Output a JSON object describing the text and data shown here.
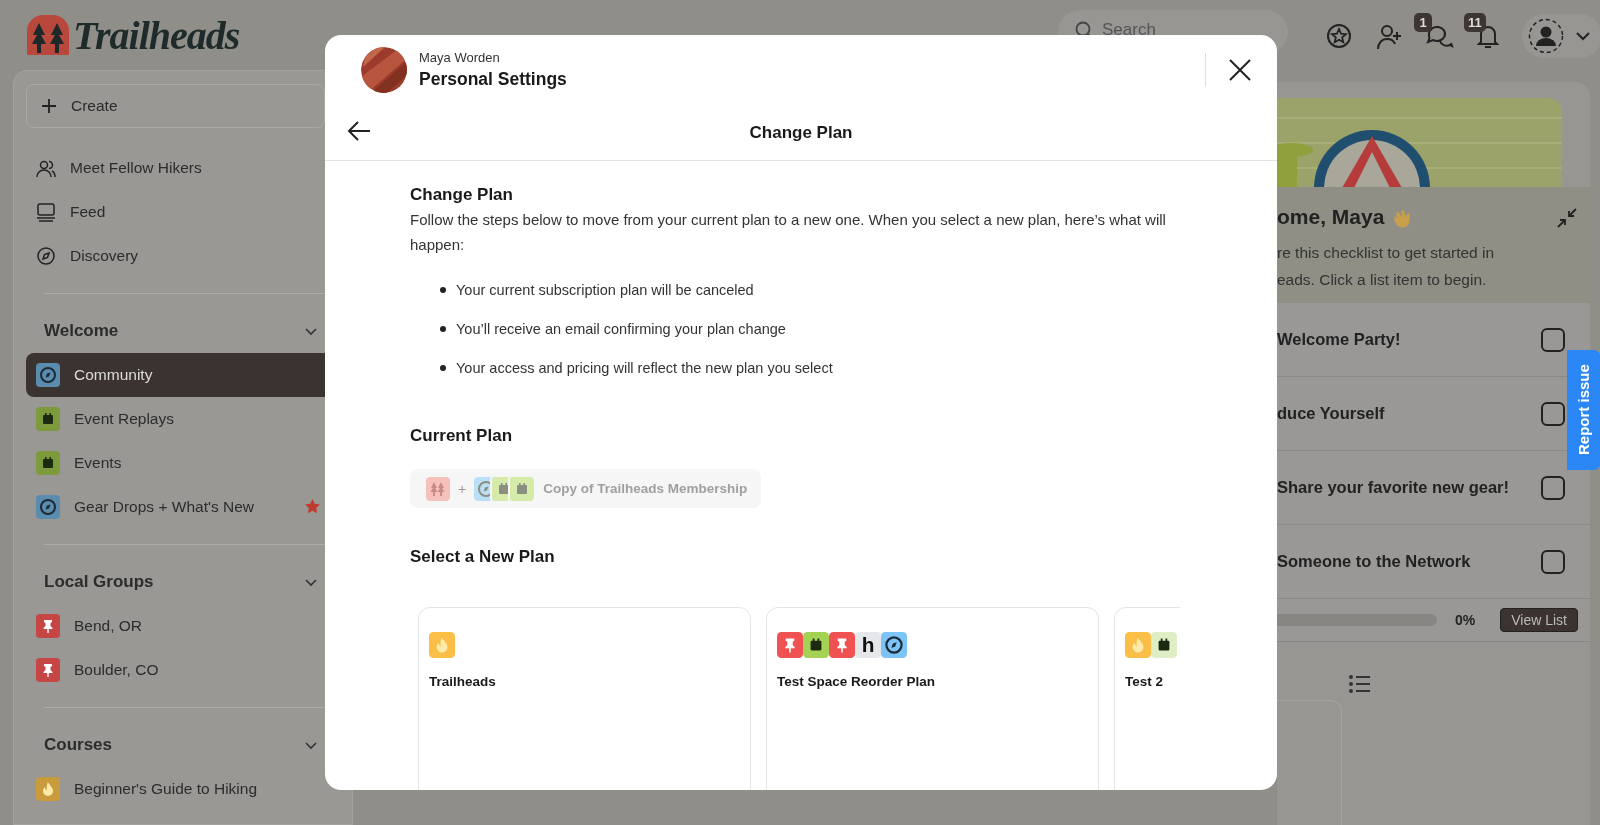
{
  "header": {
    "logo": "Trailheads",
    "search": {
      "placeholder": "Search"
    },
    "badges": [
      {
        "kind": "chat",
        "count": "1"
      },
      {
        "kind": "bell",
        "count": "11"
      }
    ]
  },
  "sidebar": {
    "create": "Create",
    "nav": [
      {
        "kind": "people",
        "label": "Meet Fellow Hikers"
      },
      {
        "kind": "feed",
        "label": "Feed"
      },
      {
        "kind": "compass",
        "label": "Discovery"
      }
    ],
    "sections": [
      {
        "title": "Welcome",
        "expanded": true,
        "items": [
          {
            "label": "Community",
            "kind": "compass",
            "color": "#5a8cb0",
            "selected": true,
            "starred": false
          },
          {
            "label": "Event Replays",
            "kind": "calendar",
            "color": "#7d9a3c",
            "selected": false,
            "starred": false
          },
          {
            "label": "Events",
            "kind": "calendar",
            "color": "#7d9a3c",
            "selected": false,
            "starred": false
          },
          {
            "label": "Gear Drops + What's New",
            "kind": "compass",
            "color": "#5a8cb0",
            "selected": false,
            "starred": true
          }
        ]
      },
      {
        "title": "Local Groups",
        "expanded": true,
        "items": [
          {
            "label": "Bend, OR",
            "kind": "pin",
            "color": "#c64545",
            "selected": false,
            "starred": false
          },
          {
            "label": "Boulder, CO",
            "kind": "pin",
            "color": "#c64545",
            "selected": false,
            "starred": false
          }
        ]
      },
      {
        "title": "Courses",
        "expanded": true,
        "items": [
          {
            "label": "Beginner's Guide to Hiking",
            "kind": "flame",
            "color": "#c89b3c",
            "selected": false,
            "starred": false
          }
        ]
      }
    ]
  },
  "modal": {
    "user": "Maya Worden",
    "title": "Personal Settings",
    "page_title": "Change Plan",
    "heading": "Change Plan",
    "intro": "Follow the steps below to move from your current plan to a new one. When you select a new plan, here’s what will happen:",
    "bullets": [
      "Your current subscription plan will be canceled",
      "You’ll receive an email confirming your plan change",
      "Your access and pricing will reflect the new plan you select"
    ],
    "current_plan": {
      "heading": "Current Plan",
      "lead_icon": {
        "kind": "trees",
        "color": "#f6c1bb"
      },
      "joiner": "+",
      "icons": [
        {
          "kind": "compass",
          "color": "#bcdff8"
        },
        {
          "kind": "calendar",
          "color": "#d6eaa9"
        },
        {
          "kind": "calendar",
          "color": "#d6eaa9"
        }
      ],
      "name": "Copy of Trailheads Membership"
    },
    "select_heading": "Select a New Plan",
    "plans": [
      {
        "name": "Trailheads",
        "icons": [
          {
            "kind": "flame",
            "color": "#fbbf47"
          }
        ]
      },
      {
        "name": "Test Space Reorder Plan",
        "icons": [
          {
            "kind": "pin",
            "color": "#f05252"
          },
          {
            "kind": "calendar",
            "color": "#a3d254"
          },
          {
            "kind": "pin",
            "color": "#f05252"
          },
          {
            "kind": "letter",
            "text": "h",
            "color": "#e5e7eb"
          },
          {
            "kind": "compass",
            "color": "#7cc4f8"
          }
        ]
      },
      {
        "name": "Test 2",
        "icons": [
          {
            "kind": "flame",
            "color": "#fbbf47"
          },
          {
            "kind": "calendar",
            "color": "#dfeec4"
          }
        ]
      }
    ]
  },
  "checklist": {
    "title": "ome, Maya",
    "lines": [
      "re this checklist to get started in",
      "eads. Click a list item to begin."
    ],
    "items": [
      {
        "label": "Welcome Party!",
        "checked": false
      },
      {
        "label": "duce Yourself",
        "checked": false
      },
      {
        "label": "Share your favorite new gear!",
        "checked": false
      },
      {
        "label": "Someone to the Network",
        "checked": false
      }
    ],
    "progress": {
      "level": 0,
      "reading": "0%"
    },
    "button": "View List"
  },
  "report": "Report issue"
}
